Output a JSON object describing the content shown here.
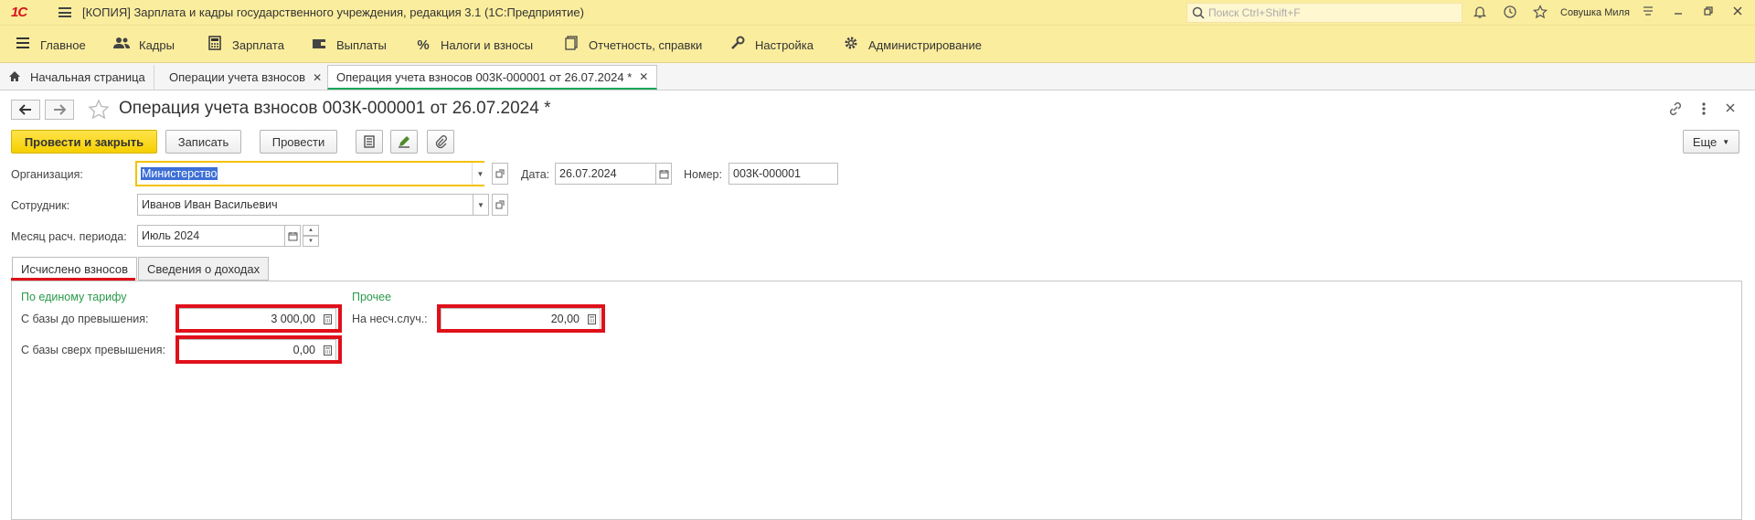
{
  "window": {
    "logo": "1С",
    "title": "[КОПИЯ] Зарплата и кадры государственного учреждения, редакция 3.1  (1С:Предприятие)",
    "search_placeholder": "Поиск Ctrl+Shift+F",
    "user": "Совушка Миля"
  },
  "menu": [
    {
      "label": "Главное",
      "icon": "list-icon"
    },
    {
      "label": "Кадры",
      "icon": "people-icon"
    },
    {
      "label": "Зарплата",
      "icon": "calculator-icon"
    },
    {
      "label": "Выплаты",
      "icon": "wallet-icon"
    },
    {
      "label": "Налоги и взносы",
      "icon": "percent-icon"
    },
    {
      "label": "Отчетность, справки",
      "icon": "reports-icon"
    },
    {
      "label": "Настройка",
      "icon": "wrench-icon"
    },
    {
      "label": "Администрирование",
      "icon": "gear-icon"
    }
  ],
  "open_tabs": [
    {
      "label": "Начальная страница"
    },
    {
      "label": "Операции учета взносов"
    },
    {
      "label": "Операция учета взносов 003К-000001 от 26.07.2024 *"
    }
  ],
  "document": {
    "title": "Операция учета взносов 003К-000001 от 26.07.2024 *",
    "buttons": {
      "post_close": "Провести и закрыть",
      "save": "Записать",
      "post": "Провести",
      "more": "Еще"
    },
    "fields": {
      "org_label": "Организация:",
      "org_value": "Министерство",
      "date_label": "Дата:",
      "date_value": "26.07.2024",
      "number_label": "Номер:",
      "number_value": "003К-000001",
      "employee_label": "Сотрудник:",
      "employee_value": "Иванов Иван Васильевич",
      "month_label": "Месяц расч. периода:",
      "month_value": "Июль 2024"
    },
    "tabs": [
      "Исчислено взносов",
      "Сведения о доходах"
    ],
    "panel": {
      "group1_title": "По единому тарифу",
      "base_under_label": "С базы до превышения:",
      "base_under_value": "3 000,00",
      "base_over_label": "С базы сверх превышения:",
      "base_over_value": "0,00",
      "group2_title": "Прочее",
      "accident_label": "На несч.случ.:",
      "accident_value": "20,00"
    }
  },
  "colors": {
    "header_bg": "#fbed9e",
    "primary_button": "#f5cf00",
    "group_title": "#2a9a4a",
    "highlight": "#e0101a"
  }
}
